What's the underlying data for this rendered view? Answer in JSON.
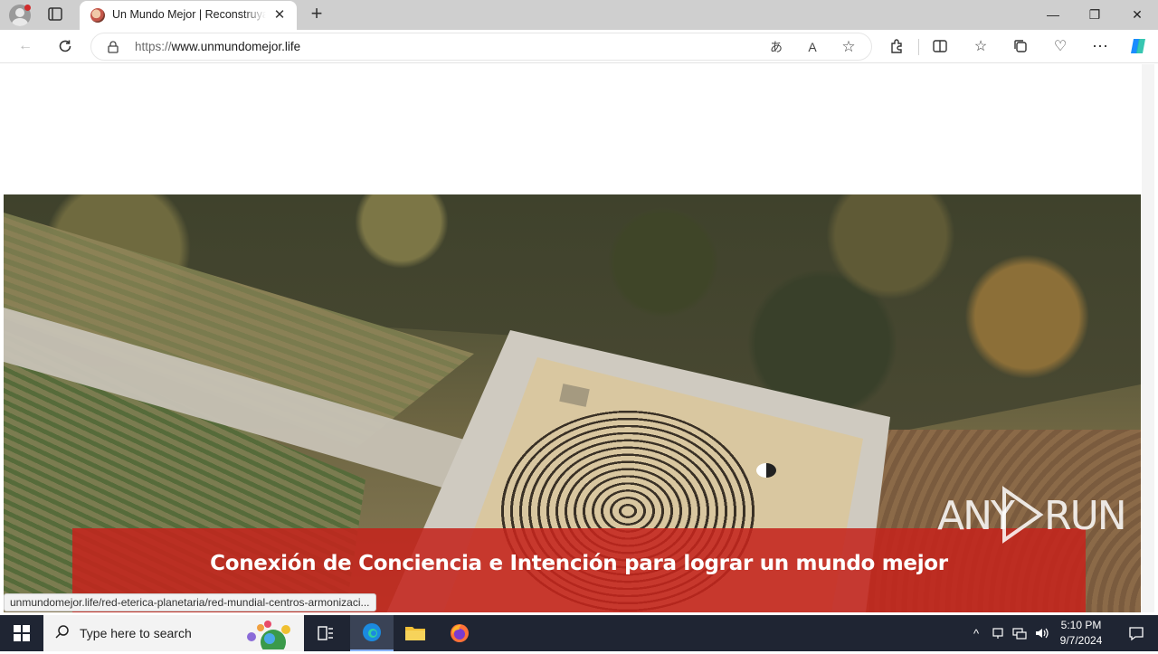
{
  "browser": {
    "tab_title": "Un Mundo Mejor | Reconstruyamos",
    "url_protocol": "https://",
    "url_host": "www.unmundomejor.life",
    "status_link": "unmundomejor.life/red-eterica-planetaria/red-mundial-centros-armonizaci...",
    "window_controls": {
      "minimize": "—",
      "restore": "❐",
      "close": "✕"
    }
  },
  "page": {
    "hero_banner_text": "Conexión de Conciencia e Intención para lograr un mundo mejor"
  },
  "watermark": {
    "left": "ANY",
    "right": "RUN"
  },
  "taskbar": {
    "search_placeholder": "Type here to search",
    "time": "5:10 PM",
    "date": "9/7/2024"
  }
}
